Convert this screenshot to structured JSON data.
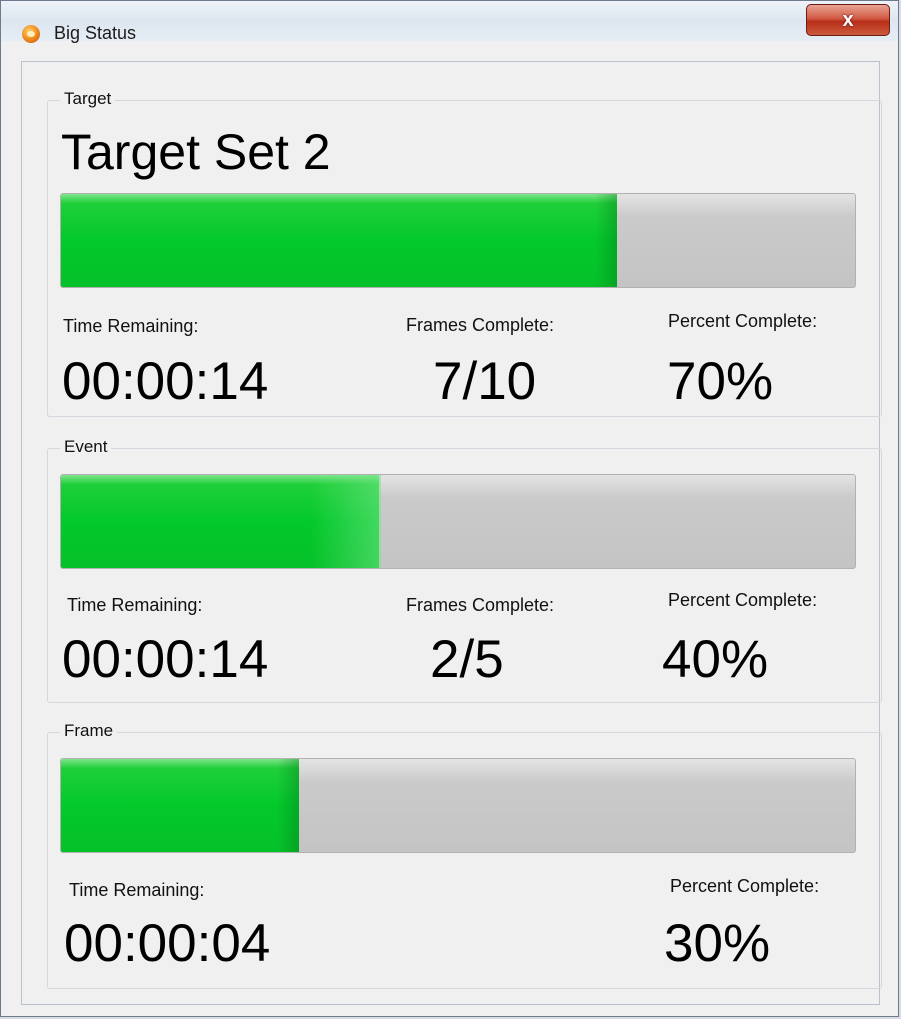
{
  "window": {
    "title": "Big Status",
    "close_label": "x"
  },
  "colors": {
    "progress_fill": "#03c92b",
    "progress_track": "#c6c6c6",
    "close_button": "#c73a22"
  },
  "target": {
    "group_label": "Target",
    "name": "Target Set 2",
    "progress_percent": 70,
    "time_remaining_label": "Time Remaining:",
    "time_remaining": "00:00:14",
    "frames_complete_label": "Frames Complete:",
    "frames_complete": "7/10",
    "percent_complete_label": "Percent Complete:",
    "percent_complete": "70%"
  },
  "event": {
    "group_label": "Event",
    "progress_percent": 40,
    "time_remaining_label": "Time Remaining:",
    "time_remaining": "00:00:14",
    "frames_complete_label": "Frames Complete:",
    "frames_complete": "2/5",
    "percent_complete_label": "Percent Complete:",
    "percent_complete": "40%"
  },
  "frame": {
    "group_label": "Frame",
    "progress_percent": 30,
    "time_remaining_label": "Time Remaining:",
    "time_remaining": "00:00:04",
    "percent_complete_label": "Percent Complete:",
    "percent_complete": "30%"
  }
}
